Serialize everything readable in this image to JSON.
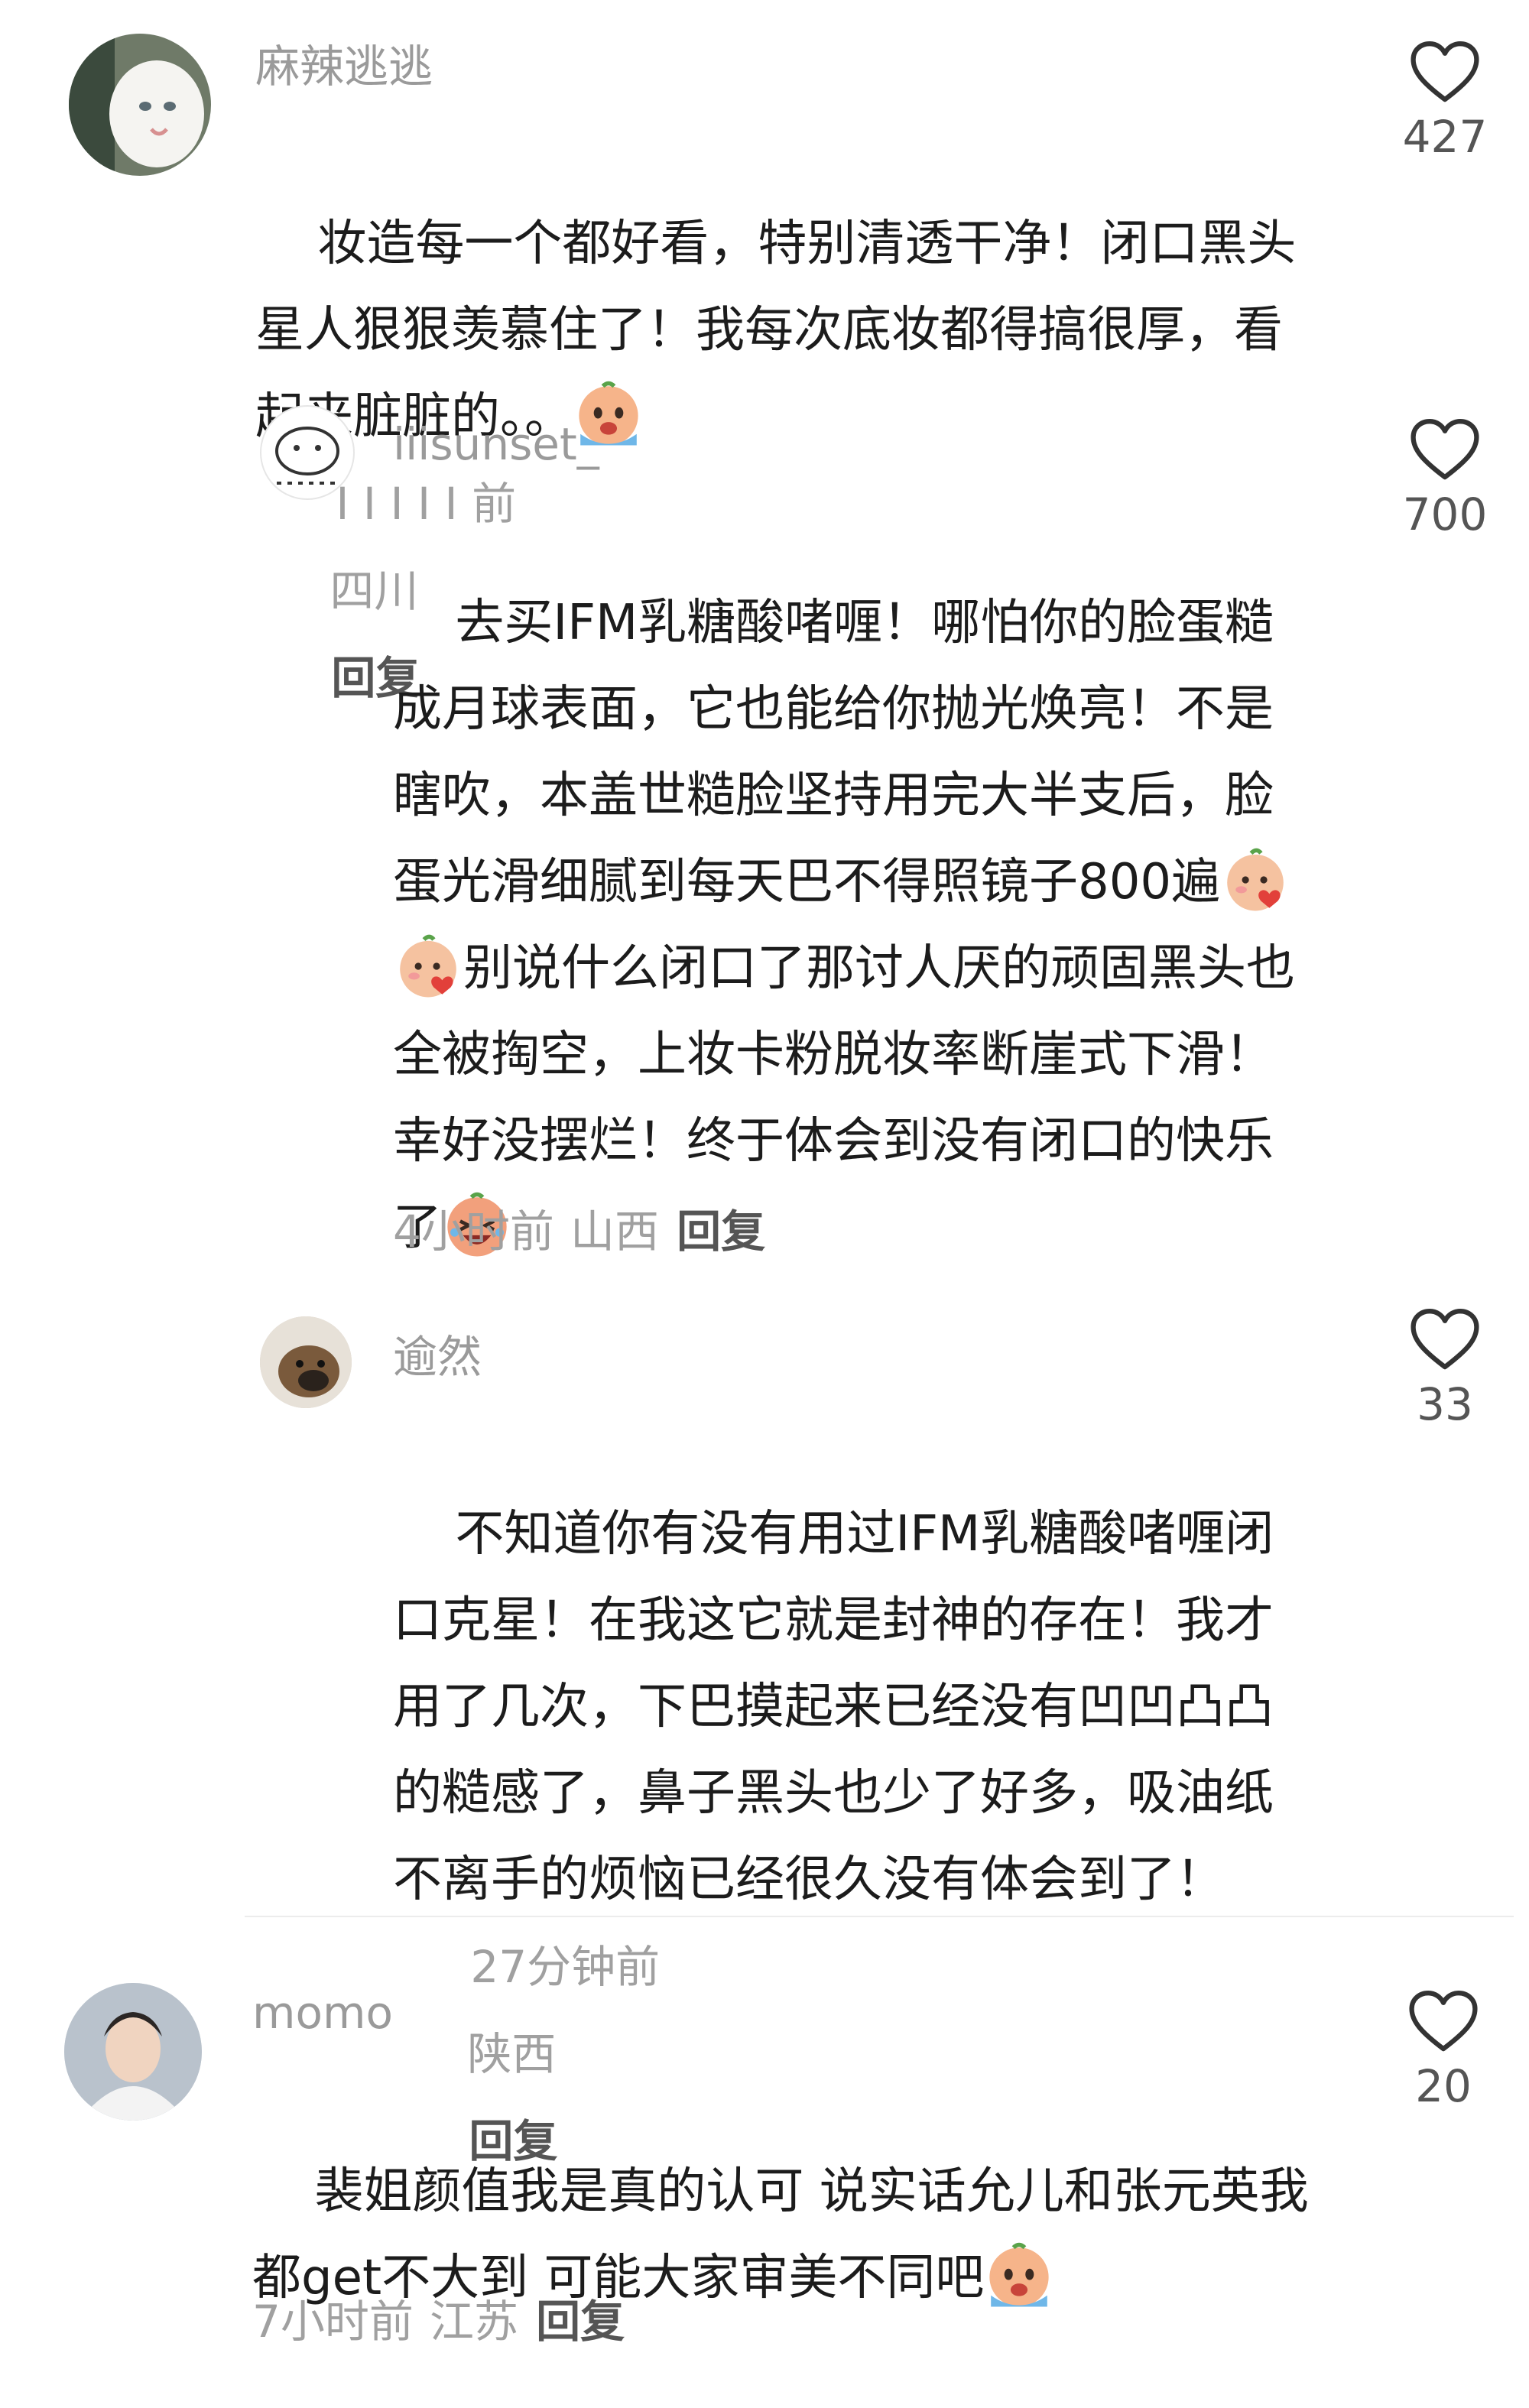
{
  "colors": {
    "text": "#1c1c1c",
    "meta": "#a0a0a0",
    "name": "#9a9a9a",
    "heart": "#333333"
  },
  "comments": [
    {
      "user": "麻辣逃逃",
      "text": "妆造每一个都好看，特别清透干净！闭口黑头星人狠狠羡慕住了！我每次底妆都得搞很厚，看起来脏脏的。。",
      "emoji": "crying-face-icon",
      "time": "I I I I I 前",
      "location": "四川",
      "reply": "回复",
      "likes": "427",
      "avatar": "white-cat-avatar"
    },
    {
      "user": "iiisunset_",
      "text": "去买IFM乳糖酸啫喱！哪怕你的脸蛋糙成月球表面，它也能给你抛光焕亮！不是瞎吹，本盖世糙脸坚持用完大半支后，脸蛋光滑细腻到每天巴不得照镜子800遍",
      "text2": "别说什么闭口了那讨人厌的顽固黑头也全被掏空，上妆卡粉脱妆率断崖式下滑！幸好没摆烂！终于体会到没有闭口的快乐了",
      "time": "4小时前",
      "location": "山西",
      "reply": "回复",
      "likes": "700",
      "avatar": "doodle-avatar"
    },
    {
      "user": "逾然",
      "text": "不知道你有没有用过IFM乳糖酸啫喱闭口克星！在我这它就是封神的存在！我才用了几次，下巴摸起来已经没有凹凹凸凸的糙感了，鼻子黑头也少了好多，吸油纸不离手的烦恼已经很久没有体会到了！",
      "time": "27分钟前",
      "location": "陕西",
      "reply": "回复",
      "likes": "33",
      "avatar": "dog-avatar"
    },
    {
      "user": "momo",
      "text": "裴姐颜值我是真的认可 说实话允儿和张元英我都get不大到 可能大家审美不同吧",
      "time": "7小时前",
      "location": "江苏",
      "reply": "回复",
      "likes": "20",
      "avatar": "person-avatar"
    }
  ]
}
